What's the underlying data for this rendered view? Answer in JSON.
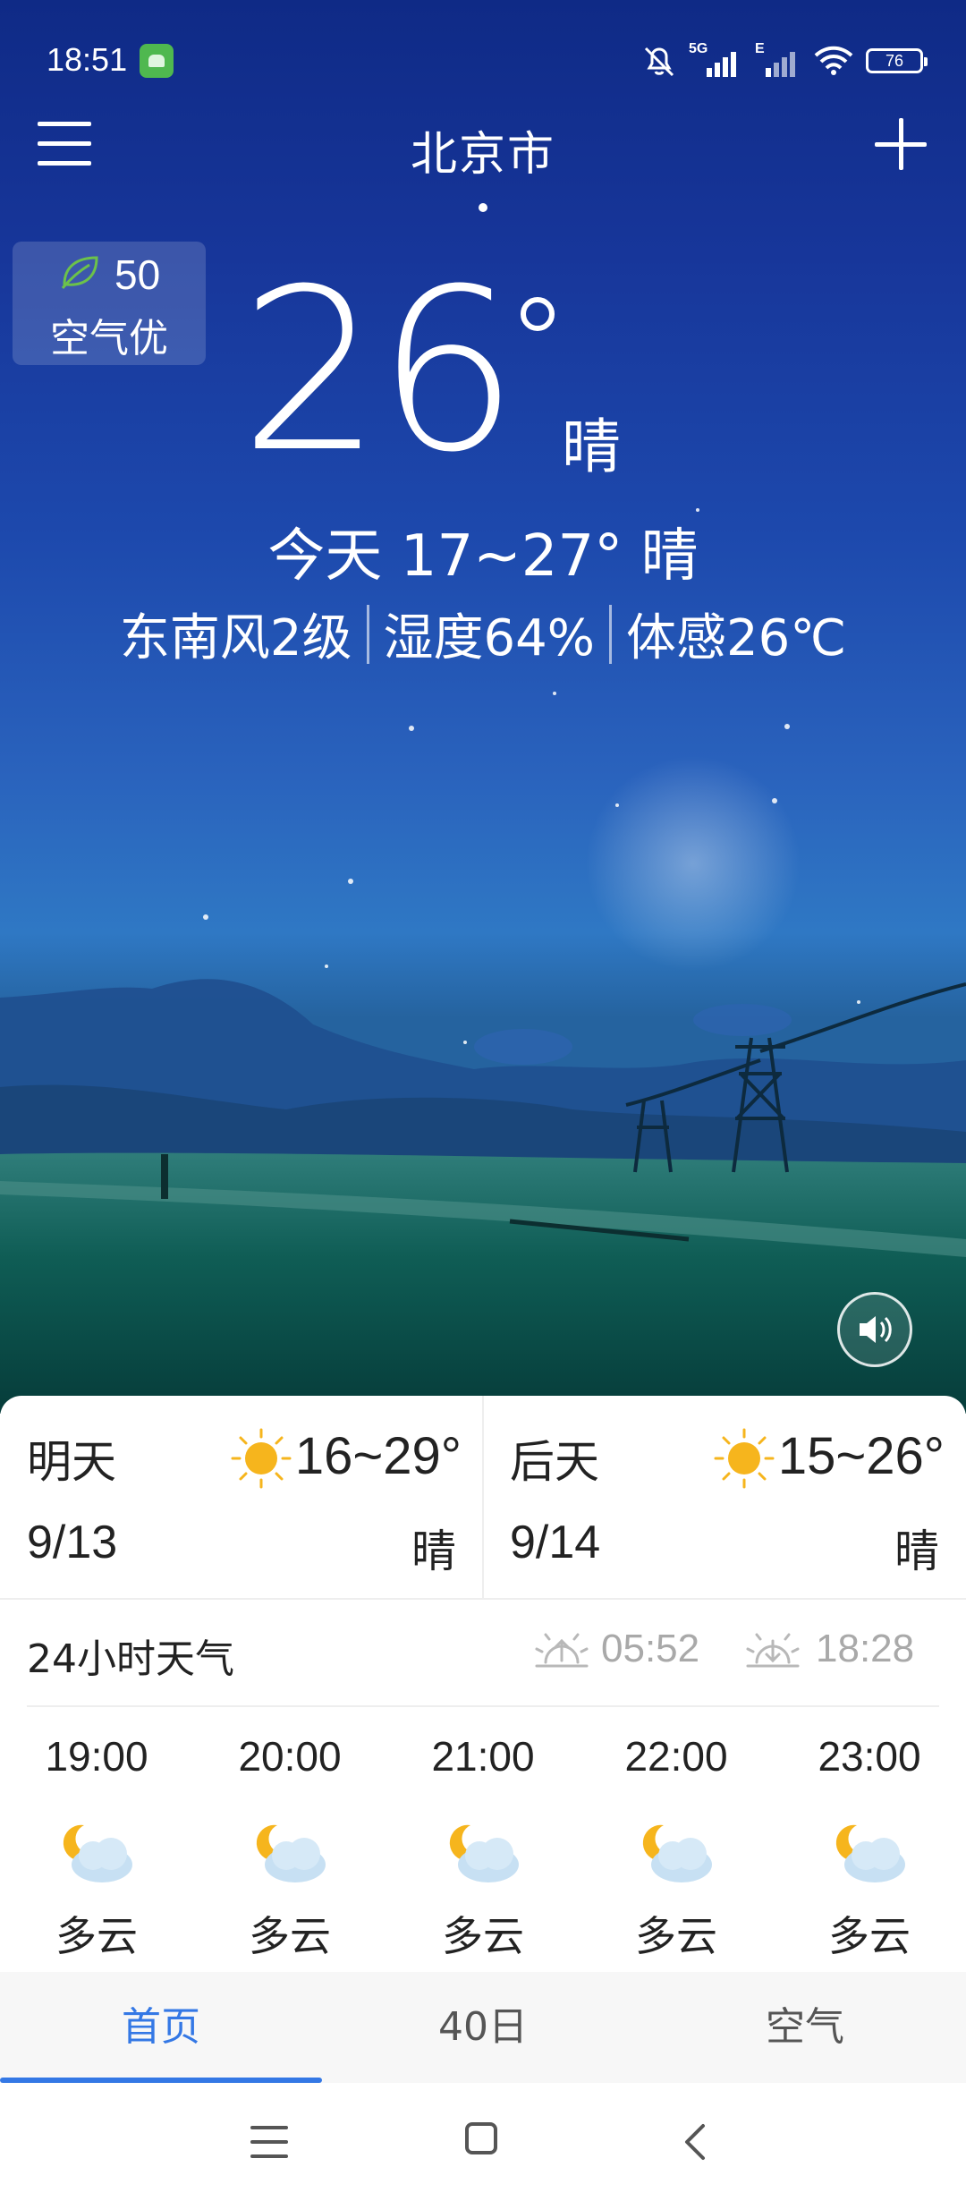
{
  "status_bar": {
    "time": "18:51",
    "network": "5G",
    "network2": "E",
    "battery": "76"
  },
  "header": {
    "city": "北京市"
  },
  "aqi": {
    "value": "50",
    "label": "空气优"
  },
  "current": {
    "temperature": "26",
    "condition": "晴",
    "today_summary": "今天 17~27° 晴",
    "wind": "东南风2级",
    "humidity": "湿度64%",
    "feels_like": "体感26℃"
  },
  "forecast": [
    {
      "day": "明天",
      "date": "9/13",
      "range": "16~29°",
      "condition": "晴",
      "icon": "sun-icon"
    },
    {
      "day": "后天",
      "date": "9/14",
      "range": "15~26°",
      "condition": "晴",
      "icon": "sun-icon"
    }
  ],
  "hourly_section": {
    "title": "24小时天气",
    "sunrise": "05:52",
    "sunset": "18:28"
  },
  "hourly": [
    {
      "time": "19:00",
      "condition": "多云",
      "icon": "partly-cloudy-night-icon"
    },
    {
      "time": "20:00",
      "condition": "多云",
      "icon": "partly-cloudy-night-icon"
    },
    {
      "time": "21:00",
      "condition": "多云",
      "icon": "partly-cloudy-night-icon"
    },
    {
      "time": "22:00",
      "condition": "多云",
      "icon": "partly-cloudy-night-icon"
    },
    {
      "time": "23:00",
      "condition": "多云",
      "icon": "partly-cloudy-night-icon"
    }
  ],
  "tabs": [
    {
      "label": "首页",
      "active": true
    },
    {
      "label": "40日",
      "active": false
    },
    {
      "label": "空气",
      "active": false
    }
  ],
  "colors": {
    "accent": "#3478e5",
    "aqi_leaf": "#6cc24a",
    "sun": "#f6b51d"
  }
}
